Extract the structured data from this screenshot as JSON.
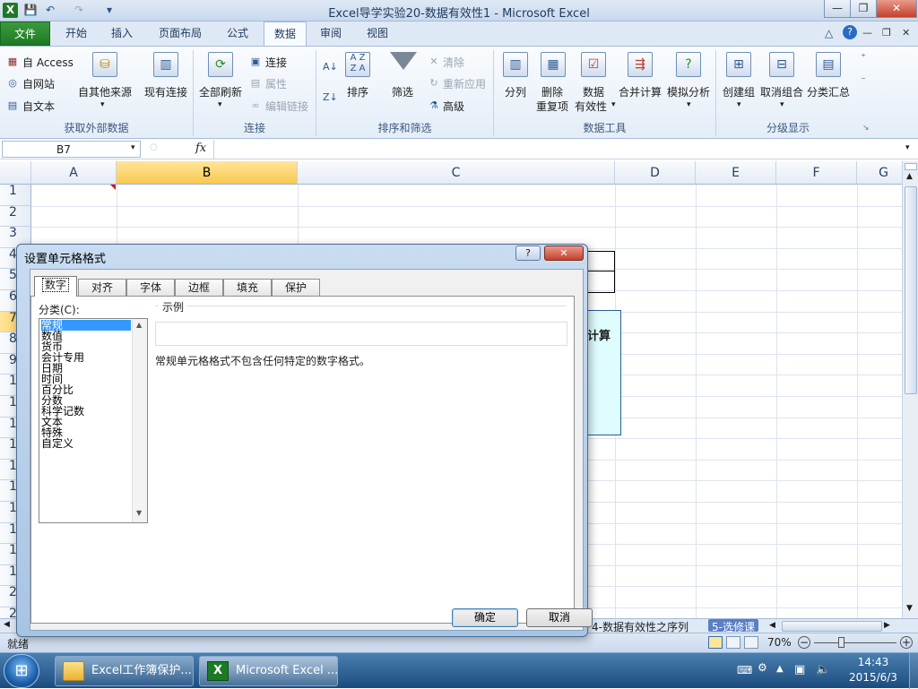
{
  "window": {
    "title": "Excel导学实验20-数据有效性1  -  Microsoft Excel",
    "minimize": "—",
    "restore": "❐",
    "close": "✕"
  },
  "quick_access": [
    "💾",
    "↶",
    "↷",
    "▾"
  ],
  "ribbon_tabs": [
    {
      "label": "文件",
      "kind": "file"
    },
    {
      "label": "开始"
    },
    {
      "label": "插入"
    },
    {
      "label": "页面布局"
    },
    {
      "label": "公式"
    },
    {
      "label": "数据",
      "active": true
    },
    {
      "label": "审阅"
    },
    {
      "label": "视图"
    }
  ],
  "ribbon_right_icons": [
    "△",
    "?",
    "—",
    "❐",
    "✕"
  ],
  "groups": {
    "external": {
      "label": "获取外部数据",
      "access": "自 Access",
      "web": "自网站",
      "text": "自文本",
      "other": "自其他来源",
      "existing": "现有连接"
    },
    "connections": {
      "label": "连接",
      "refresh_all": "全部刷新",
      "connections": "连接",
      "properties": "属性",
      "edit_links": "编辑链接"
    },
    "sort_filter": {
      "label": "排序和筛选",
      "sort": "排序",
      "filter": "筛选",
      "clear": "清除",
      "reapply": "重新应用",
      "advanced": "高级"
    },
    "data_tools": {
      "label": "数据工具",
      "text_to_columns": "分列",
      "remove_dup_1": "删除",
      "remove_dup_2": "重复项",
      "validation_1": "数据",
      "validation_2": "有效性",
      "consolidate": "合并计算",
      "what_if": "模拟分析"
    },
    "outline": {
      "label": "分级显示",
      "group": "创建组",
      "ungroup": "取消组合",
      "subtotal": "分类汇总"
    }
  },
  "formula_bar": {
    "name_box": "B7",
    "fx": "fx"
  },
  "columns": [
    "A",
    "B",
    "C",
    "D",
    "E",
    "F",
    "G"
  ],
  "rows": [
    "1",
    "2",
    "3",
    "4",
    "5",
    "6",
    "7",
    "8",
    "9",
    "10",
    "11",
    "12",
    "13",
    "14",
    "15",
    "16",
    "17",
    "18",
    "19",
    "20",
    "21",
    "22"
  ],
  "sheet_tabs": {
    "tab1": "4-数据有效性之序列",
    "tab2": "5-选修课"
  },
  "status": {
    "ready": "就绪",
    "zoom": "70%"
  },
  "shape_text": "计算",
  "dialog": {
    "title": "设置单元格格式",
    "help": "?",
    "close": "✕",
    "tabs": [
      "数字",
      "对齐",
      "字体",
      "边框",
      "填充",
      "保护"
    ],
    "category_label": "分类(C):",
    "categories": [
      "常规",
      "数值",
      "货币",
      "会计专用",
      "日期",
      "时间",
      "百分比",
      "分数",
      "科学记数",
      "文本",
      "特殊",
      "自定义"
    ],
    "sample_label": "示例",
    "description": "常规单元格格式不包含任何特定的数字格式。",
    "ok": "确定",
    "cancel": "取消"
  },
  "taskbar": {
    "start": "⊞",
    "btn1": "Excel工作簿保护...",
    "btn2": "Microsoft Excel ...",
    "time": "14:43",
    "date": "2015/6/3"
  }
}
